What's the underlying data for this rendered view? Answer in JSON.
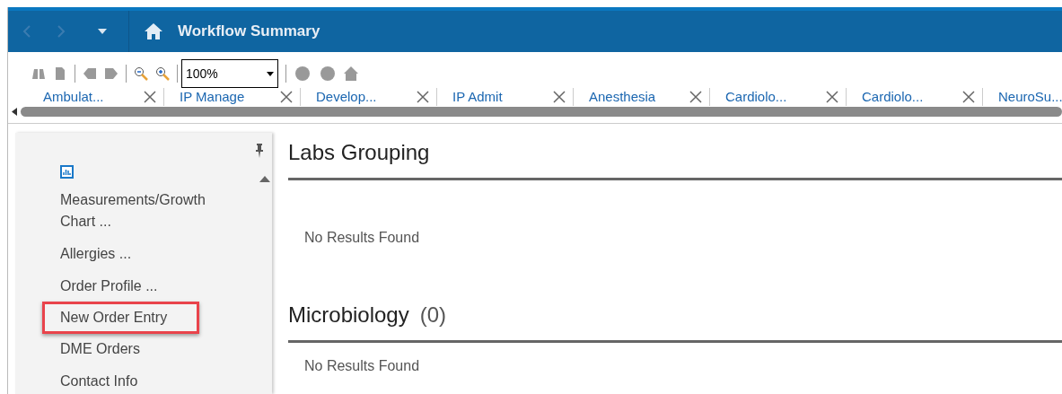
{
  "header": {
    "title": "Workflow Summary"
  },
  "toolbar": {
    "zoom": "100%"
  },
  "tabs": [
    {
      "label": "Ambulat..."
    },
    {
      "label": "IP Manage"
    },
    {
      "label": "Develop..."
    },
    {
      "label": "IP Admit"
    },
    {
      "label": "Anesthesia"
    },
    {
      "label": "Cardiolo..."
    },
    {
      "label": "Cardiolo..."
    },
    {
      "label": "NeuroSu..."
    }
  ],
  "sidebar": {
    "items": [
      {
        "label": "Measurements/Growth Chart ...",
        "kind": "chart",
        "highlighted": false
      },
      {
        "label": "Allergies ...",
        "kind": "link",
        "highlighted": false
      },
      {
        "label": "Order Profile ...",
        "kind": "link",
        "highlighted": false
      },
      {
        "label": "New Order Entry",
        "kind": "link",
        "highlighted": true
      },
      {
        "label": "DME Orders",
        "kind": "link",
        "highlighted": false
      },
      {
        "label": "Contact Info",
        "kind": "link",
        "highlighted": false
      }
    ]
  },
  "sections": [
    {
      "title": "Labs Grouping",
      "message": "No Results Found"
    },
    {
      "title": "Microbiology",
      "count": "(0)",
      "message": "No Results Found"
    }
  ]
}
